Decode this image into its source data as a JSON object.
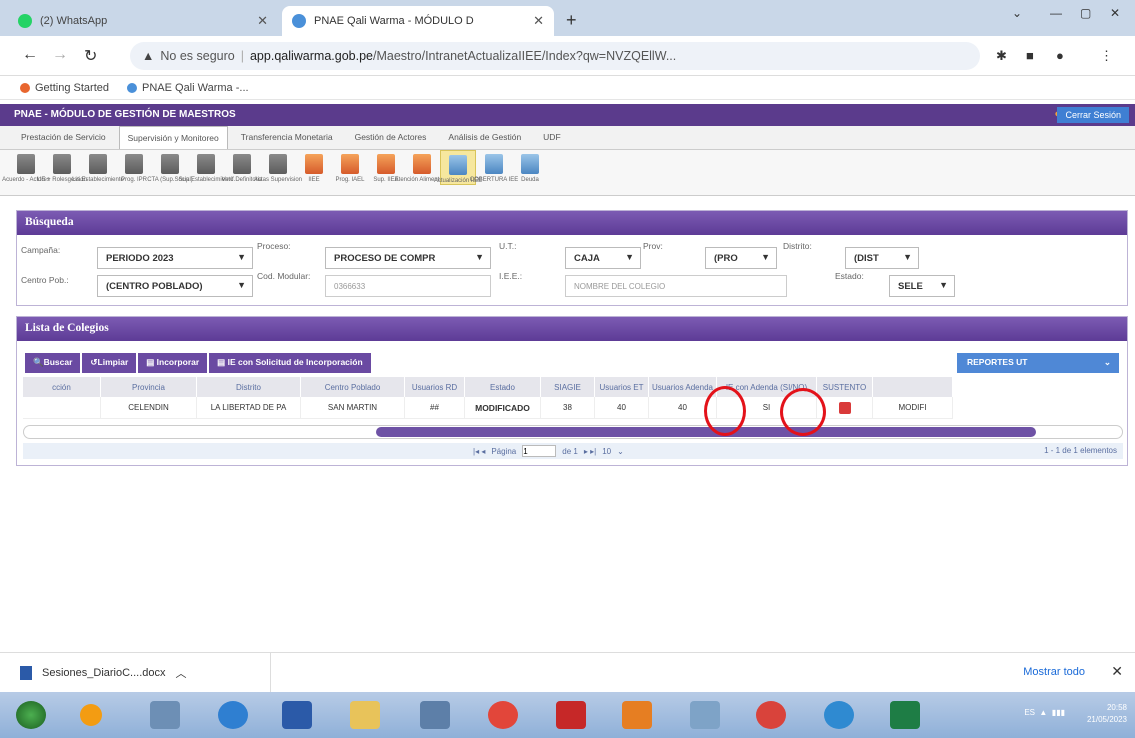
{
  "browser": {
    "tabs": [
      {
        "title": "(2) WhatsApp",
        "color": "#25d366"
      },
      {
        "title": "PNAE Qali Warma - MÓDULO D",
        "color": "#4a90d9"
      }
    ],
    "address": {
      "security": "No es seguro",
      "host": "app.qaliwarma.gob.pe",
      "path": "/Maestro/IntranetActualizaIIEE/Index?qw=NVZQEllW..."
    },
    "bookmarks": [
      "Getting Started",
      "PNAE Qali Warma -..."
    ]
  },
  "app": {
    "header_title": "PNAE - MÓDULO DE GESTIÓN DE MAESTROS",
    "logout_label": "Cerrar Sesión",
    "menu": [
      "Prestación de Servicio",
      "Supervisión y Monitoreo",
      "Transferencia Monetaria",
      "Gestión de Actores",
      "Análisis de Gestión",
      "UDF"
    ],
    "active_menu": "Supervisión y Monitoreo",
    "icons": [
      {
        "label": "Acuerdo - Actores",
        "kind": "case"
      },
      {
        "label": "UE + Rolesgestion",
        "kind": "case"
      },
      {
        "label": "Lis.Establecimiento",
        "kind": "case"
      },
      {
        "label": "Prog. IPR",
        "kind": "case"
      },
      {
        "label": "CTA (Sup.Social)",
        "kind": "case"
      },
      {
        "label": "Sup.Establecimiento",
        "kind": "case"
      },
      {
        "label": "Verif.Definitoria",
        "kind": "case"
      },
      {
        "label": "Actas Supervision",
        "kind": "case"
      },
      {
        "label": "IIEE",
        "kind": "food"
      },
      {
        "label": "Prog. IAEL",
        "kind": "food"
      },
      {
        "label": "Sup. IIEE",
        "kind": "food"
      },
      {
        "label": "Atención Alimentaria",
        "kind": "food"
      },
      {
        "label": "Actualización IIEE",
        "kind": "doc",
        "active": true
      },
      {
        "label": "COBERTURA IEE",
        "kind": "doc"
      },
      {
        "label": "Deuda",
        "kind": "doc"
      }
    ]
  },
  "search": {
    "title": "Búsqueda",
    "campana_label": "Campaña:",
    "campana_value": "PERIODO 2023",
    "proceso_label": "Proceso:",
    "proceso_value": "PROCESO DE COMPR",
    "ut_label": "U.T.:",
    "ut_value": "CAJA",
    "prov_label": "Prov:",
    "prov_value": "(PRO",
    "distrito_label": "Distrito:",
    "distrito_value": "(DIST",
    "centro_label": "Centro Pob.:",
    "centro_value": "(CENTRO POBLADO)",
    "cod_label": "Cod. Modular:",
    "cod_value": "0366633",
    "iiee_label": "I.E.E.:",
    "iiee_placeholder": "NOMBRE DEL COLEGIO",
    "estado_label": "Estado:",
    "estado_value": "SELE"
  },
  "list": {
    "title": "Lista de Colegios",
    "buttons": [
      "Buscar",
      "Limpiar",
      "Incorporar",
      "IE con Solicitud de Incorporación"
    ],
    "reports_label": "REPORTES UT",
    "columns": [
      "cción",
      "Provincia",
      "Distrito",
      "Centro Poblado",
      "Usuarios RD",
      "Estado",
      "SIAGIE",
      "Usuarios ET",
      "Usuarios Adenda",
      "IE con Adenda (SI/NO)",
      "SUSTENTO",
      ""
    ],
    "rows": [
      [
        "",
        "CELENDIN",
        "LA LIBERTAD DE PA",
        "SAN MARTIN",
        "##",
        "MODIFICADO",
        "38",
        "40",
        "40",
        "SI",
        "",
        "MODIFI"
      ]
    ],
    "pager": {
      "page_label": "Página",
      "page_value": "1",
      "of_label": "de 1",
      "size": "10",
      "summary": "1 - 1 de 1 elementos"
    }
  },
  "downloads": {
    "file": "Sesiones_DiarioC....docx",
    "show_all": "Mostrar todo"
  },
  "taskbar": {
    "lang": "ES",
    "time": "20:58",
    "date": "21/05/2023"
  }
}
